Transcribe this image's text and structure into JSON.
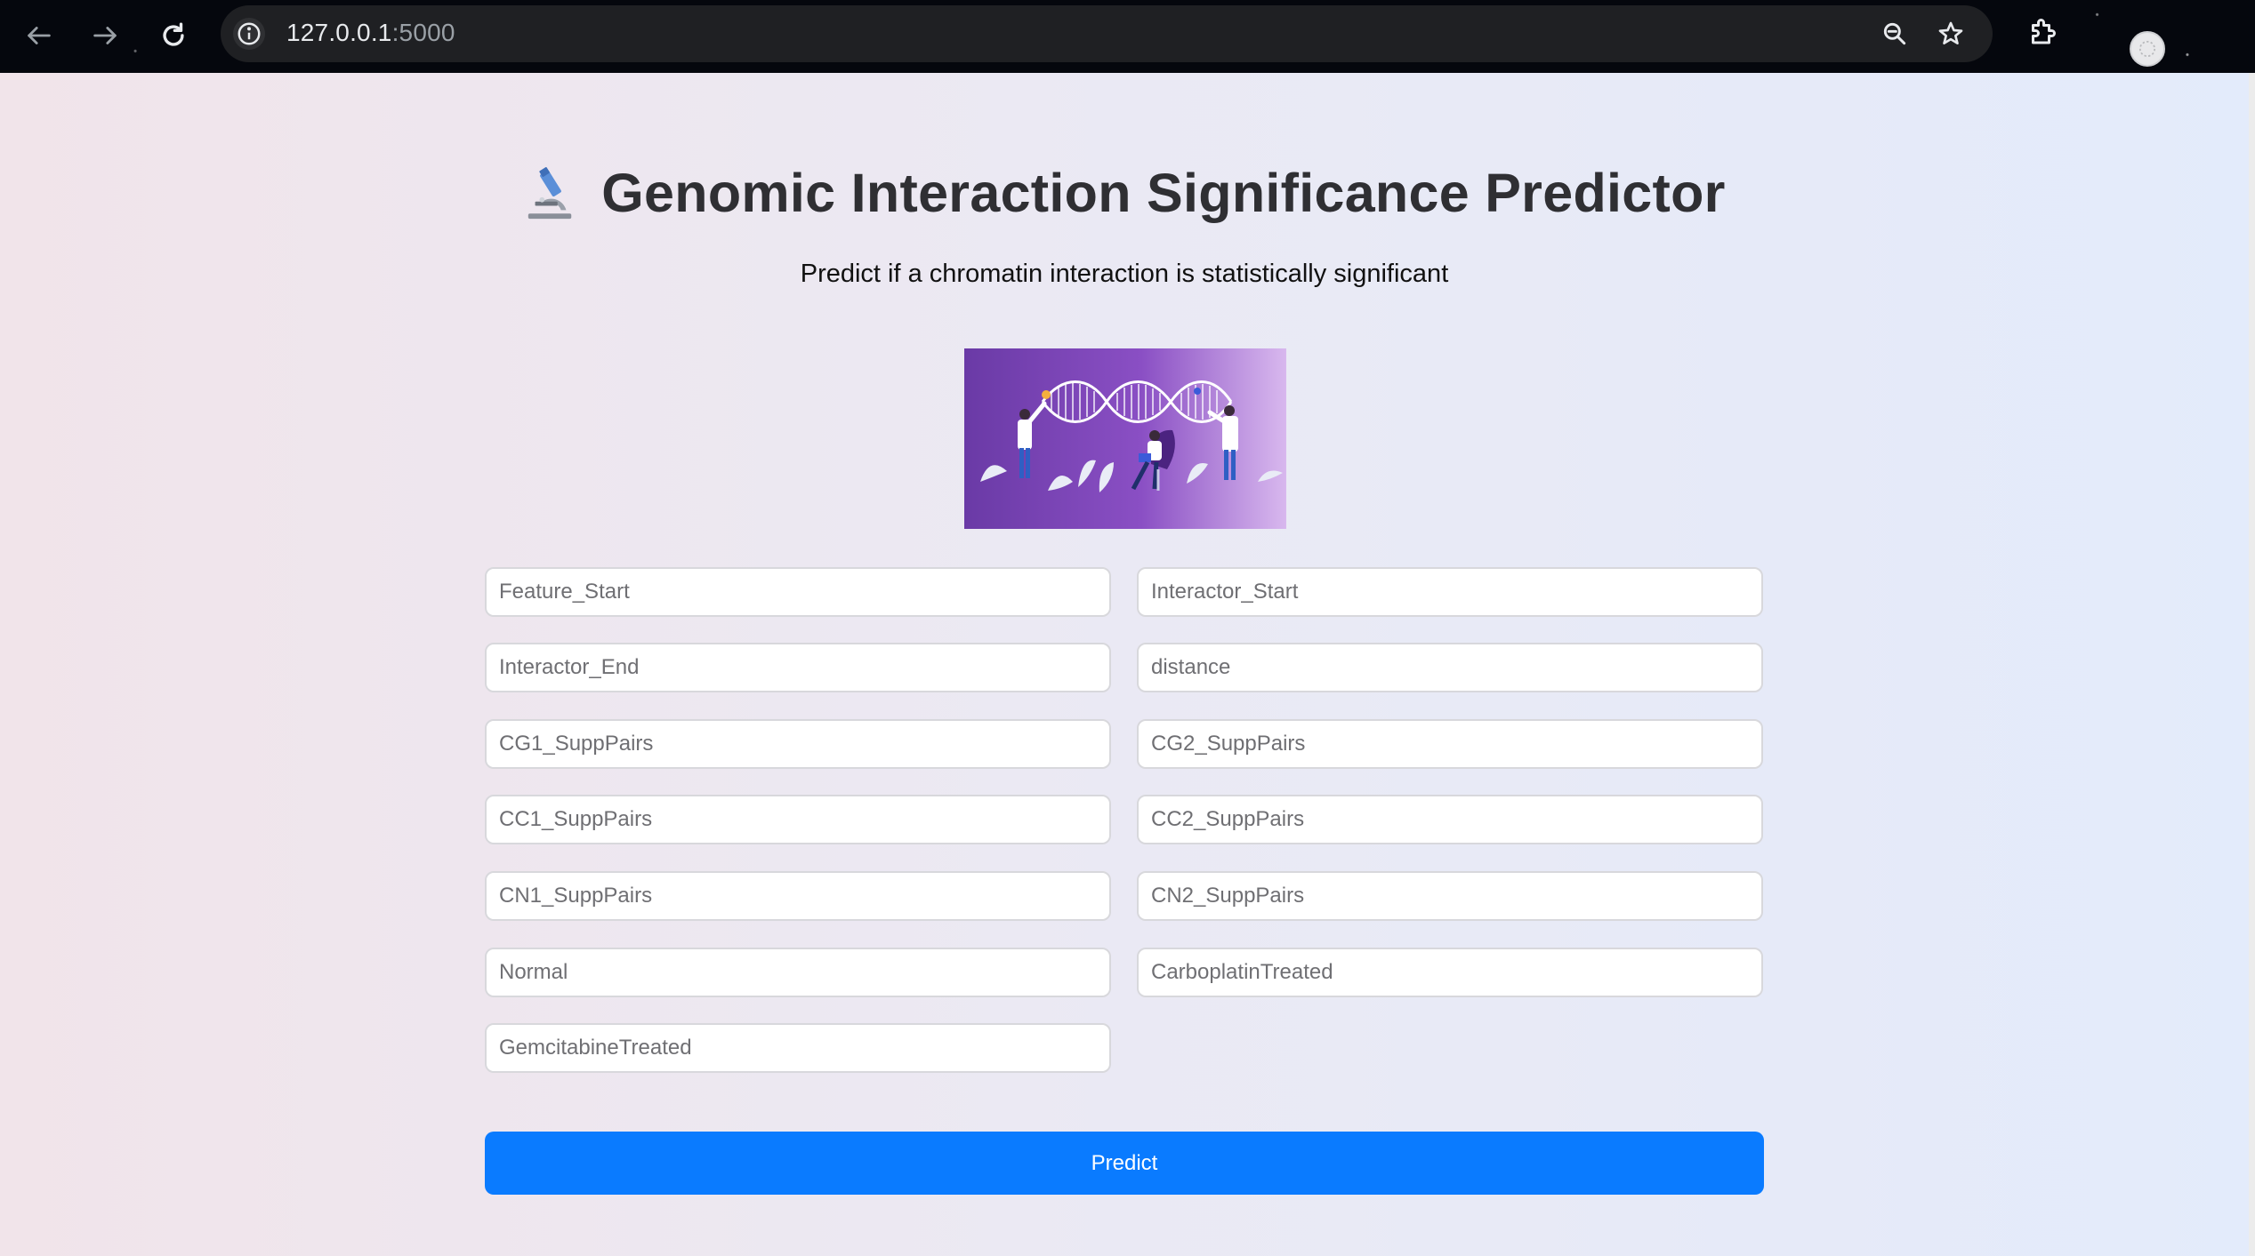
{
  "browser": {
    "url_host": "127.0.0.1",
    "url_port": ":5000",
    "icons": [
      "back-arrow-icon",
      "forward-arrow-icon",
      "reload-icon",
      "info-icon",
      "zoom-icon",
      "star-icon",
      "extensions-icon",
      "profile-icon"
    ]
  },
  "header": {
    "title": "Genomic Interaction Significance Predictor",
    "subtitle": "Predict if a chromatin interaction is statistically significant",
    "icon": "microscope-icon"
  },
  "form": {
    "fields": [
      {
        "placeholder": "Feature_Start",
        "value": ""
      },
      {
        "placeholder": "Interactor_Start",
        "value": ""
      },
      {
        "placeholder": "Interactor_End",
        "value": ""
      },
      {
        "placeholder": "distance",
        "value": ""
      },
      {
        "placeholder": "CG1_SuppPairs",
        "value": ""
      },
      {
        "placeholder": "CG2_SuppPairs",
        "value": ""
      },
      {
        "placeholder": "CC1_SuppPairs",
        "value": ""
      },
      {
        "placeholder": "CC2_SuppPairs",
        "value": ""
      },
      {
        "placeholder": "CN1_SuppPairs",
        "value": ""
      },
      {
        "placeholder": "CN2_SuppPairs",
        "value": ""
      },
      {
        "placeholder": "Normal",
        "value": ""
      },
      {
        "placeholder": "CarboplatinTreated",
        "value": ""
      },
      {
        "placeholder": "GemcitabineTreated",
        "value": ""
      }
    ],
    "submit_label": "Predict"
  },
  "colors": {
    "accent": "#0a7bff",
    "title": "#2f2f33",
    "hero_bg": "#7b3fb0"
  }
}
